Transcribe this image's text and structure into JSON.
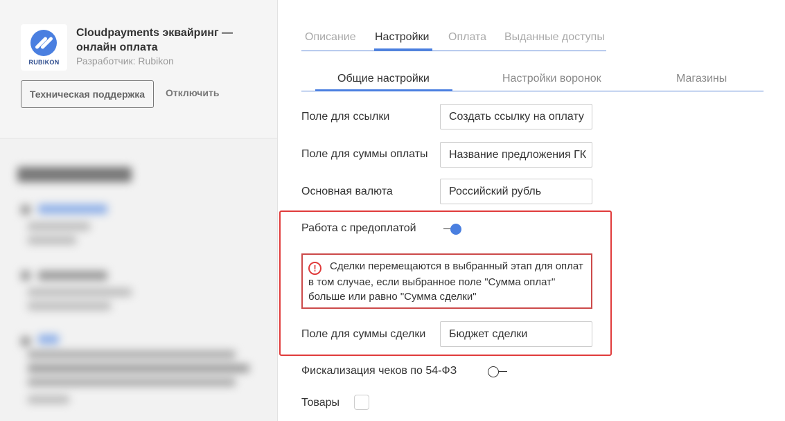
{
  "app": {
    "logo_text": "RUBIKON",
    "title": "Cloudpayments эквайринг — онлайн оплата",
    "developer": "Разработчик: Rubikon",
    "support_button": "Техническая поддержка",
    "disable_link": "Отключить"
  },
  "tabs": [
    {
      "label": "Описание",
      "active": false
    },
    {
      "label": "Настройки",
      "active": true
    },
    {
      "label": "Оплата",
      "active": false
    },
    {
      "label": "Выданные доступы",
      "active": false
    }
  ],
  "subtabs": [
    {
      "label": "Общие настройки",
      "active": true
    },
    {
      "label": "Настройки воронок",
      "active": false
    },
    {
      "label": "Магазины",
      "active": false
    }
  ],
  "settings": {
    "link_field": {
      "label": "Поле для ссылки",
      "value": "Создать ссылку на оплату"
    },
    "amount_field": {
      "label": "Поле для суммы оплаты",
      "value": "Название предложения ГК"
    },
    "currency": {
      "label": "Основная валюта",
      "value": "Российский рубль"
    },
    "prepayment": {
      "label": "Работа с предоплатой",
      "enabled": true
    },
    "warning": {
      "icon": "!",
      "text": "Сделки перемещаются в выбранный этап для оплат в том случае, если выбранное поле \"Сумма оплат\" больше или равно \"Сумма сделки\""
    },
    "deal_amount_field": {
      "label": "Поле для суммы сделки",
      "value": "Бюджет сделки"
    },
    "fiscalization": {
      "label": "Фискализация чеков по 54-ФЗ",
      "enabled": false
    },
    "goods": {
      "label": "Товары",
      "checked": false
    }
  },
  "colors": {
    "accent": "#4a7fe0",
    "highlight": "#e03b3b"
  }
}
